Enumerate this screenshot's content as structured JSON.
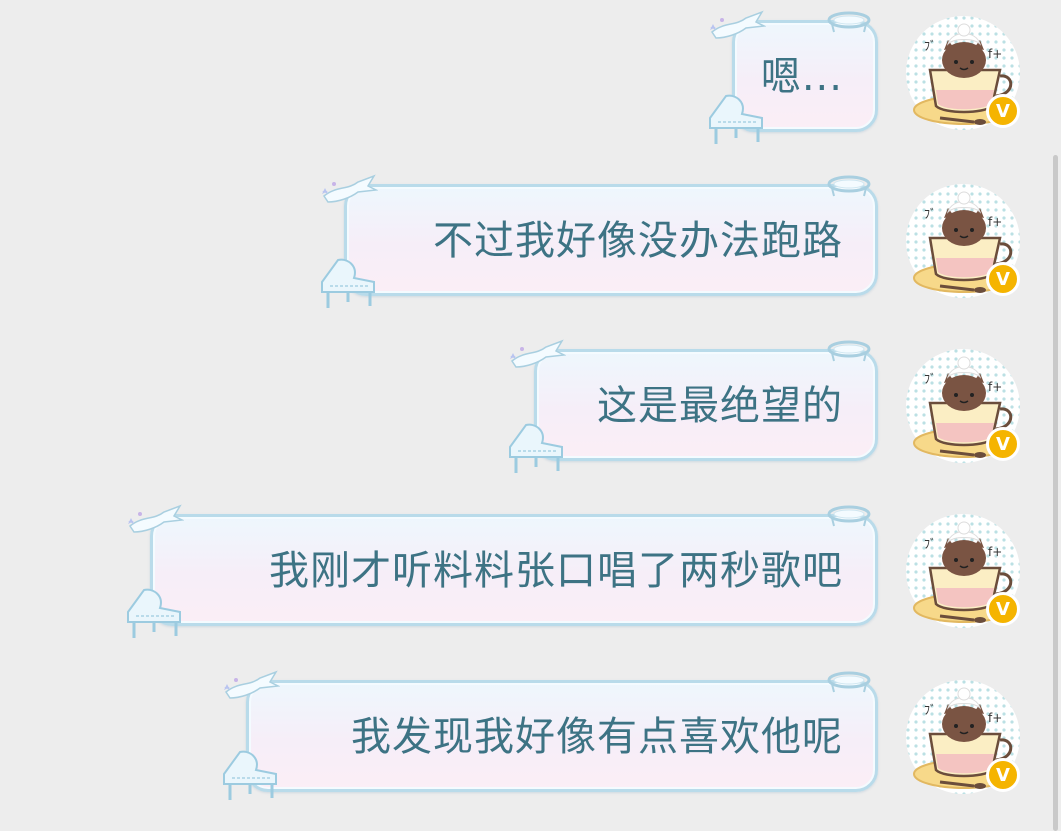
{
  "chat": {
    "messages": [
      {
        "text": "嗯...",
        "sender": "self",
        "verified_badge": "V"
      },
      {
        "text": "不过我好像没办法跑路",
        "sender": "self",
        "verified_badge": "V"
      },
      {
        "text": "这是最绝望的",
        "sender": "self",
        "verified_badge": "V"
      },
      {
        "text": "我刚才听料料张口唱了两秒歌吧",
        "sender": "self",
        "verified_badge": "V"
      },
      {
        "text": "我发现我好像有点喜欢他呢",
        "sender": "self",
        "verified_badge": "V"
      }
    ]
  },
  "icons": {
    "avatar": "cat-in-teacup-avatar",
    "badge": "verified-v-badge",
    "bubble_decor": [
      "ribbon-icon",
      "halo-ring-icon",
      "piano-icon"
    ]
  },
  "colors": {
    "background": "#ededed",
    "bubble_border": "#b9dbea",
    "bubble_text": "#3d7384",
    "badge": "#f5b400"
  }
}
